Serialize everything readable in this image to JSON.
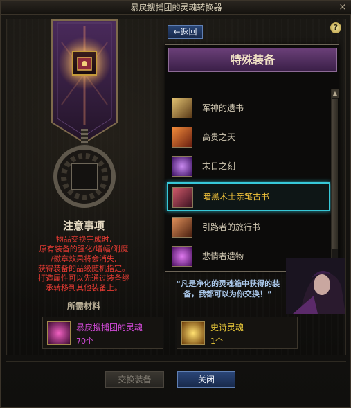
{
  "window": {
    "title": "暴戾搜捕团的灵魂转换器",
    "close_glyph": "×"
  },
  "header": {
    "back_label": "返回",
    "back_arrow": "←",
    "help_glyph": "?"
  },
  "notice": {
    "title": "注意事项",
    "lines": [
      "物品交换完成时,",
      "原有装备的强化/增幅/附魔",
      "/徽章效果将会消失,",
      "获得装备的品级随机指定。",
      "打造属性可以先通过装备继",
      "承转移到其他装备上。"
    ],
    "required_label": "所需材料"
  },
  "dropdown": {
    "header": "特殊装备",
    "items": [
      {
        "label": "军神的遗书",
        "icon": "scroll-blade-icon",
        "color": "#c9a14a"
      },
      {
        "label": "高贵之天",
        "icon": "red-book-icon",
        "color": "#d06a2a"
      },
      {
        "label": "末日之刻",
        "icon": "purple-orb-icon",
        "color": "#8a3fc0"
      },
      {
        "label": "暗黑术士亲笔古书",
        "icon": "dark-tome-icon",
        "color": "#a03a50",
        "selected": true
      },
      {
        "label": "引路者的旅行书",
        "icon": "travel-book-icon",
        "color": "#c06a3a"
      },
      {
        "label": "悲情者遗物",
        "icon": "relic-orb-icon",
        "color": "#b04ac8"
      }
    ]
  },
  "npc_quote": "“凡是净化的灵魂箱中获得的装备，我都可以为你交换！”",
  "materials": [
    {
      "name": "暴戾搜捕团的灵魂",
      "count": "70个",
      "icon": "dark-soul-icon",
      "name_color": "#d24ad8",
      "count_color": "#d24ad8"
    },
    {
      "name": "史诗灵魂",
      "count": "1个",
      "icon": "epic-soul-icon",
      "name_color": "#e9c83a",
      "count_color": "#e9c83a"
    }
  ],
  "footer": {
    "exchange_label": "交换装备",
    "close_label": "关闭"
  },
  "colors": {
    "accent_cyan": "#37c8d8",
    "notice_red": "#e33a32",
    "button_blue": "#2a4677"
  }
}
